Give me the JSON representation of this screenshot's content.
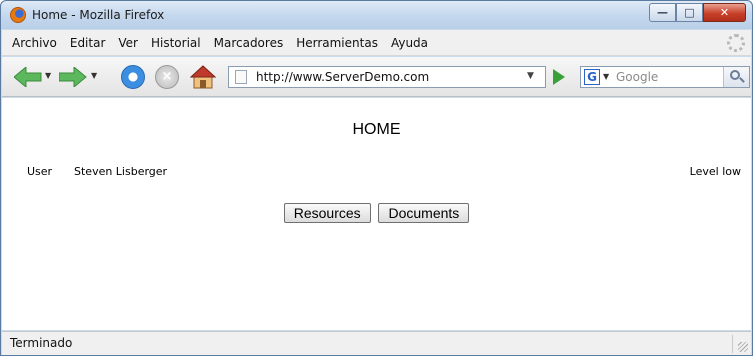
{
  "window": {
    "title": "Home - Mozilla Firefox",
    "controls": [
      "minimize",
      "maximize",
      "close"
    ]
  },
  "menubar": {
    "items": [
      {
        "label": "Archivo"
      },
      {
        "label": "Editar"
      },
      {
        "label": "Ver"
      },
      {
        "label": "Historial"
      },
      {
        "label": "Marcadores"
      },
      {
        "label": "Herramientas"
      },
      {
        "label": "Ayuda"
      }
    ]
  },
  "toolbar": {
    "icons": [
      "back-icon",
      "forward-icon",
      "reload-icon",
      "stop-icon",
      "home-icon"
    ],
    "url": "http://www.ServerDemo.com",
    "search_engine": "google-icon",
    "search_placeholder": "Google"
  },
  "page": {
    "heading": "HOME",
    "user_label": "User",
    "user_name": "Steven Lisberger",
    "level_label": "Level low",
    "buttons": {
      "resources": "Resources",
      "documents": "Documents"
    }
  },
  "status": {
    "text": "Terminado"
  }
}
